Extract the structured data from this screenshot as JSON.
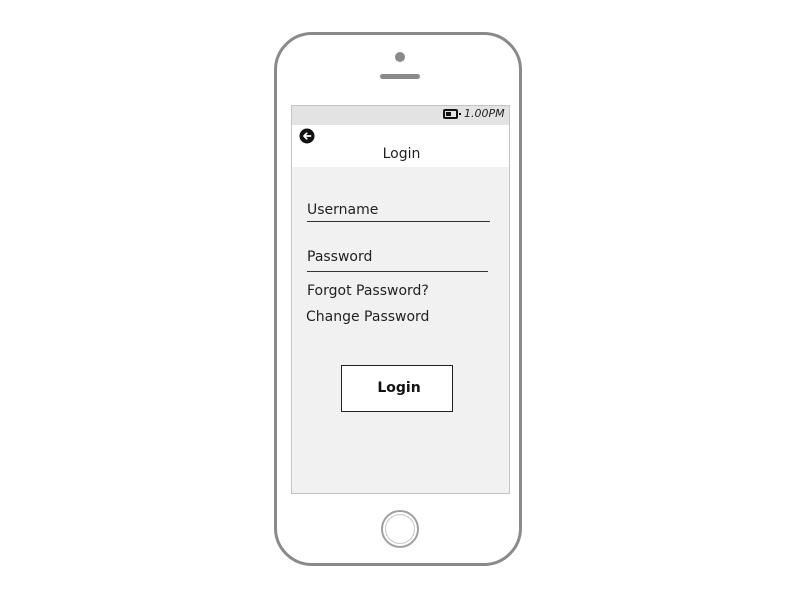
{
  "status_bar": {
    "time": "1.00PM",
    "battery_icon": "battery-icon"
  },
  "header": {
    "back_icon": "back-arrow-icon",
    "title": "Login"
  },
  "form": {
    "username_label": "Username",
    "password_label": "Password",
    "forgot_password": "Forgot Password?",
    "change_password": "Change Password",
    "login_button": "Login"
  },
  "colors": {
    "screen_background": "#f1f1f1",
    "status_bar": "#e3e3e3",
    "header_background": "#ffffff",
    "phone_frame": "#8a8a8a"
  }
}
